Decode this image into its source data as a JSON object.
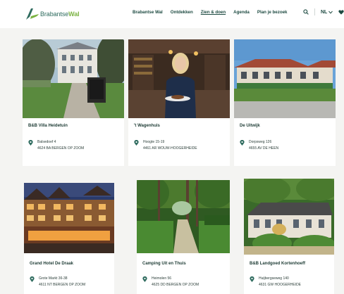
{
  "header": {
    "logo": {
      "text_a": "Brabantse",
      "text_b": "Wal"
    },
    "nav": [
      {
        "label": "Brabantse Wal"
      },
      {
        "label": "Ontdekken"
      },
      {
        "label": "Zien & doen"
      },
      {
        "label": "Agenda"
      },
      {
        "label": "Plan je bezoek"
      }
    ],
    "language": "NL",
    "icons": [
      "search-icon",
      "chevron-down-icon",
      "heart-icon"
    ]
  },
  "listings": [
    {
      "name": "B&B Villa Heidetuin",
      "address_line1": "Balsedoef 4",
      "address_line2": "4624 BA BERGEN OP ZOOM"
    },
    {
      "name": "'t Wagenhuis",
      "address_line1": "Hoogte 15-19",
      "address_line2": "4461 AR WOUW-HOOGERHEIDE"
    },
    {
      "name": "De Uitwijk",
      "address_line1": "Dorpsweg 126",
      "address_line2": "4655 AV DE HEEN"
    },
    {
      "name": "Grand Hotel De Draak",
      "address_line1": "Grote Markt 36-38",
      "address_line2": "4611 NT BERGEN OP ZOOM"
    },
    {
      "name": "Camping Uit en Thuis",
      "address_line1": "Heimolen 56",
      "address_line2": "4625 DD BERGEN OP ZOOM"
    },
    {
      "name": "B&B Landgoed Kortenhoeff",
      "address_line1": "Huijbergseweg 140",
      "address_line2": "4631 GW HOOGERHEIDE"
    }
  ],
  "colors": {
    "brand_dark": "#1d4a41",
    "brand_green": "#7bb342",
    "pin": "#2e6b5e"
  }
}
